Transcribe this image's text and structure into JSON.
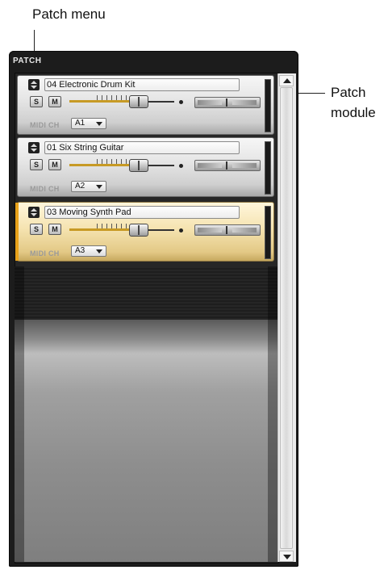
{
  "callouts": {
    "patch_menu": "Patch menu",
    "patch_module_line1": "Patch",
    "patch_module_line2": "module"
  },
  "panel": {
    "title": "PATCH"
  },
  "modules": [
    {
      "name": "04 Electronic Drum Kit",
      "solo": "S",
      "mute": "M",
      "midi_label": "MIDI CH",
      "midi_channel": "A1",
      "selected": false
    },
    {
      "name": "01 Six String Guitar",
      "solo": "S",
      "mute": "M",
      "midi_label": "MIDI CH",
      "midi_channel": "A2",
      "selected": false
    },
    {
      "name": "03 Moving Synth Pad",
      "solo": "S",
      "mute": "M",
      "midi_label": "MIDI CH",
      "midi_channel": "A3",
      "selected": true
    }
  ],
  "colors": {
    "selected_accent": "#e8a21a",
    "fader_fill": "#c79a25",
    "panel_bg": "#1c1c1c"
  },
  "icons": {
    "patch_menu": "up-down-arrows-icon",
    "scroll_up": "triangle-up-icon",
    "scroll_down": "triangle-down-icon",
    "dropdown": "chevron-down-icon"
  }
}
